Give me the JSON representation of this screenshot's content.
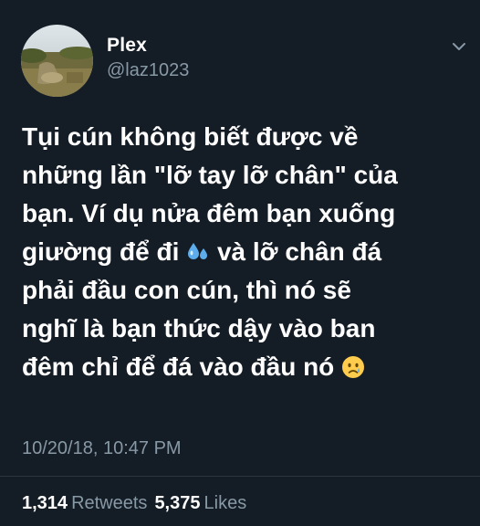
{
  "tweet": {
    "author": {
      "display_name": "Plex",
      "handle": "@laz1023"
    },
    "text_lines": [
      "Tụi cún không biết được về",
      "những lần \"lỡ tay lỡ chân\" của",
      "bạn. Ví dụ nửa đêm bạn xuống",
      [
        "giường để đi ",
        " và lỡ chân đá"
      ],
      "phải đầu con cún, thì nó sẽ",
      "nghĩ là bạn thức dậy vào ban",
      [
        "đêm chỉ để đá vào đầu nó ",
        ""
      ]
    ],
    "emojis": [
      "sweat-droplets-emoji",
      "crying-face-emoji"
    ],
    "timestamp": "10/20/18, 10:47 PM",
    "stats": {
      "retweets_count": "1,314",
      "retweets_label": "Retweets",
      "likes_count": "5,375",
      "likes_label": "Likes"
    }
  },
  "colors": {
    "background": "#141c26",
    "primary_text": "#ffffff",
    "secondary_text": "#8899a6",
    "divider": "#2a3540"
  }
}
